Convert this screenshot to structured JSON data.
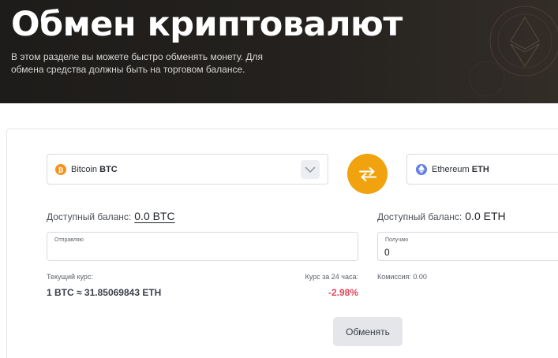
{
  "header": {
    "title": "Обмен криптовалют",
    "description_line1": "В этом разделе вы можете быстро обменять монету. Для",
    "description_line2": "обмена средства должны быть на торговом балансе."
  },
  "from": {
    "coin_name": "Bitcoin",
    "coin_ticker": "BTC",
    "balance_label": "Доступный баланс:",
    "balance_value": "0.0 BTC",
    "input_label": "Отправляю",
    "input_value": "",
    "icon": "bitcoin-icon",
    "icon_color": "#f7931a"
  },
  "to": {
    "coin_name": "Ethereum",
    "coin_ticker": "ETH",
    "balance_label": "Доступный баланс:",
    "balance_value": "0.0 ETH",
    "input_label": "Получаю",
    "input_value": "0",
    "icon": "ethereum-icon",
    "icon_color": "#627eea"
  },
  "rate": {
    "label": "Текущий курс:",
    "value": "1 BTC ≈ 31.85069843 ETH",
    "change_label": "Курс за 24 часа:",
    "change_value": "-2.98%",
    "change_color": "#e2475a"
  },
  "commission": "Комиссия: 0.00",
  "exchange_button": "Обменять",
  "colors": {
    "accent": "#f0a30e",
    "hero_bg": "#1e1c1a"
  }
}
